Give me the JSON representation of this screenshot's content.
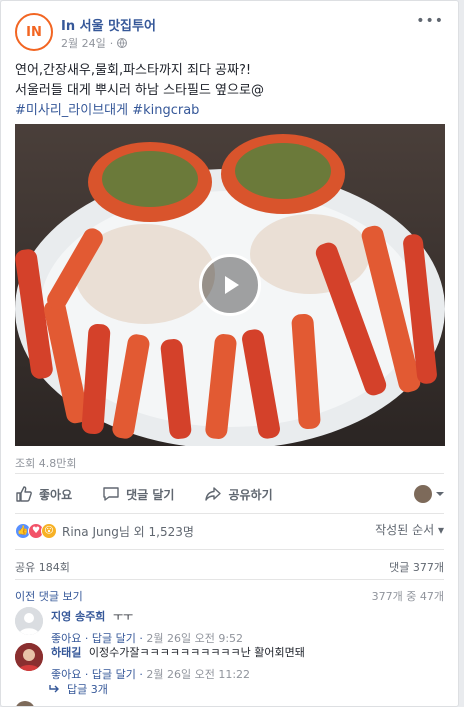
{
  "post": {
    "page_name": "In 서울 맛집투어",
    "logo_text": "IN",
    "date": "2월 24일",
    "privacy_icon": "globe-icon",
    "more_label": "•••",
    "text_line1": "연어,간장새우,물회,파스타까지 죄다 공짜?!",
    "text_line2": "서울러들 대게 뿌시러 하남 스타필드 옆으로@",
    "hashtags": "#미사리_라이브대게 #kingcrab"
  },
  "video": {
    "views": "조회 4.8만회",
    "play_icon": "play-icon"
  },
  "actions": {
    "like": "좋아요",
    "comment": "댓글 달기",
    "share": "공유하기"
  },
  "reactions": {
    "summary": "Rina Jung님 외 1,523명",
    "sort_label": "작성된 순서",
    "shares": "공유 184회",
    "comments_count": "댓글 377개",
    "prev_comments": "이전 댓글 보기",
    "page_of": "377개 중 47개"
  },
  "comments": [
    {
      "name": "지영 송주희",
      "text": "ㅜㅜ",
      "like": "좋아요",
      "reply": "답글 달기",
      "time": "2월 26일 오전 9:52"
    },
    {
      "name": "하태길",
      "text": "이정수가잘ㅋㅋㅋㅋㅋㅋㅋㅋㅋㅋ난 활어회면돼",
      "like": "좋아요",
      "reply": "답글 달기",
      "time": "2월 26일 오전 11:22"
    }
  ],
  "replies_label": "답글 3개",
  "colors": {
    "link": "#365899",
    "brand": "#f26522",
    "muted": "#90949c"
  }
}
